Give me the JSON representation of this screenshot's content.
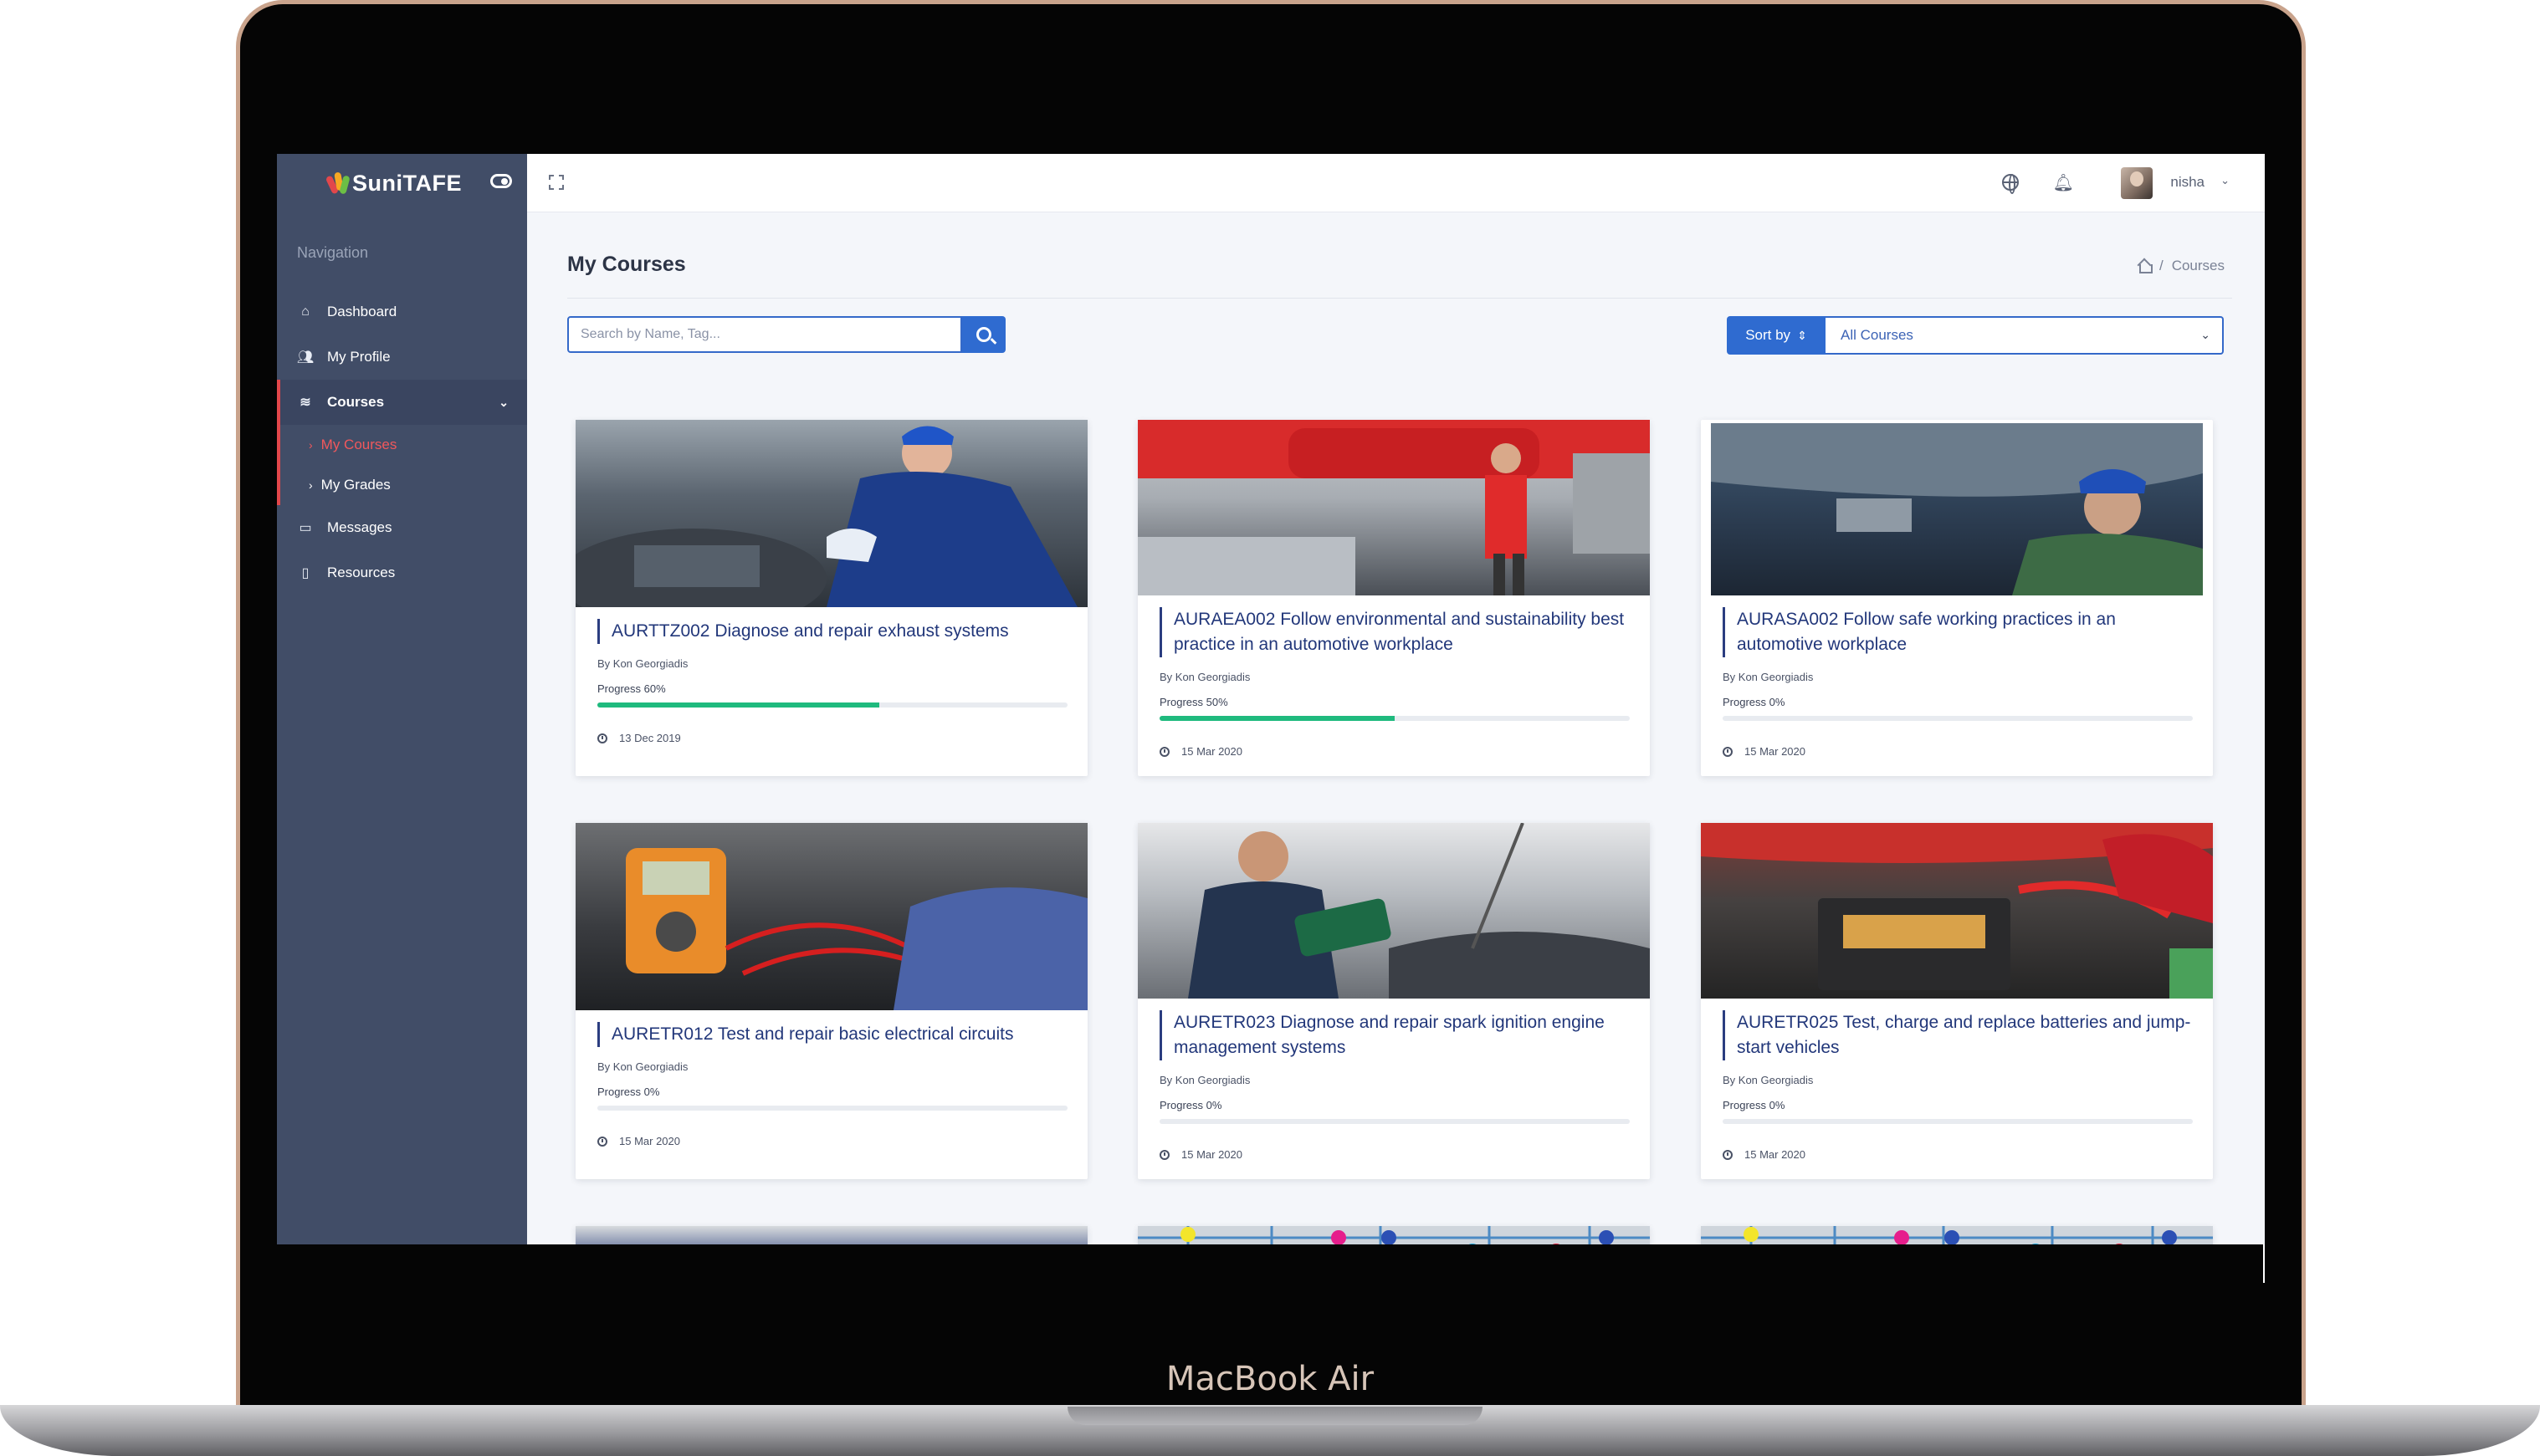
{
  "device": {
    "label": "MacBook Air"
  },
  "sidebar": {
    "brand": "SuniTAFE",
    "nav_heading": "Navigation",
    "items": [
      {
        "label": "Dashboard",
        "icon": "home-icon"
      },
      {
        "label": "My Profile",
        "icon": "users-icon"
      },
      {
        "label": "Courses",
        "icon": "layers-icon",
        "expanded": true
      },
      {
        "label": "Messages",
        "icon": "message-icon"
      },
      {
        "label": "Resources",
        "icon": "clipboard-icon"
      }
    ],
    "sub_items": [
      {
        "label": "My Courses",
        "current": true
      },
      {
        "label": "My Grades",
        "current": false
      }
    ],
    "colors": {
      "background": "#414d67",
      "active_accent": "#e2474b"
    }
  },
  "topbar": {
    "user_name": "nisha",
    "icons": [
      "expand-icon",
      "globe-icon",
      "bell-icon",
      "avatar",
      "chevron-down-icon"
    ]
  },
  "page": {
    "title": "My Courses",
    "breadcrumb": [
      "Courses"
    ],
    "search_placeholder": "Search by Name, Tag...",
    "sort_label": "Sort by",
    "filter_selected": "All Courses"
  },
  "courses": [
    {
      "code_title": "AURTTZ002 Diagnose and repair exhaust systems",
      "author": "By Kon Georgiadis",
      "progress_label": "Progress 60%",
      "progress": 0.6,
      "date": "13 Dec 2019"
    },
    {
      "code_title": "AURAEA002 Follow environmental and sustainability best practice in an automotive workplace",
      "author": "By Kon Georgiadis",
      "progress_label": "Progress 50%",
      "progress": 0.5,
      "date": "15 Mar 2020"
    },
    {
      "code_title": "AURASA002 Follow safe working practices in an automotive workplace",
      "author": "By Kon Georgiadis",
      "progress_label": "Progress 0%",
      "progress": 0,
      "date": "15 Mar 2020"
    },
    {
      "code_title": "AURETR012 Test and repair basic electrical circuits",
      "author": "By Kon Georgiadis",
      "progress_label": "Progress 0%",
      "progress": 0,
      "date": "15 Mar 2020"
    },
    {
      "code_title": "AURETR023 Diagnose and repair spark ignition engine management systems",
      "author": "By Kon Georgiadis",
      "progress_label": "Progress 0%",
      "progress": 0,
      "date": "15 Mar 2020"
    },
    {
      "code_title": "AURETR025 Test, charge and replace batteries and jump-start vehicles",
      "author": "By Kon Georgiadis",
      "progress_label": "Progress 0%",
      "progress": 0,
      "date": "15 Mar 2020"
    }
  ],
  "colors": {
    "primary": "#2f6bd0",
    "progress": "#1fba7e",
    "title_text": "#22377a"
  }
}
